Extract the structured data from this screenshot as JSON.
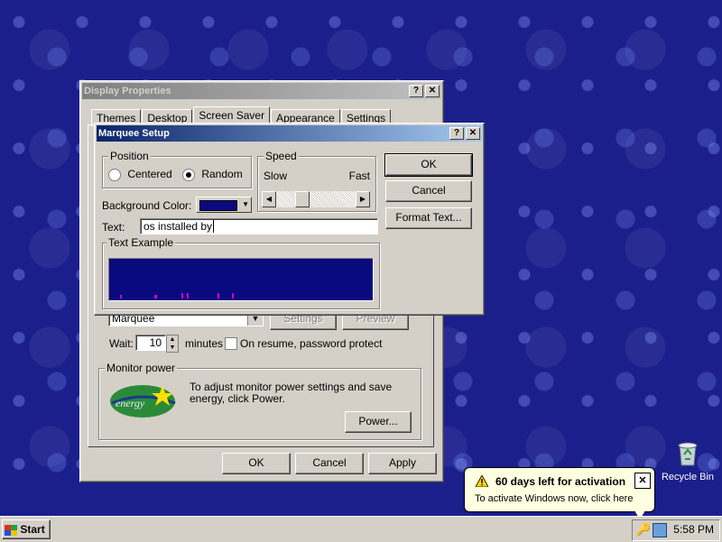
{
  "display_properties": {
    "title": "Display Properties",
    "tabs": [
      "Themes",
      "Desktop",
      "Screen Saver",
      "Appearance",
      "Settings"
    ],
    "selected_tab": "Screen Saver",
    "screensaver_select": "Marquee",
    "settings_label": "Settings",
    "preview_label": "Preview",
    "wait_label": "Wait:",
    "wait_value": "10",
    "minutes_label": "minutes",
    "resume_label": "On resume, password protect",
    "monitor_power_label": "Monitor power",
    "monitor_power_text": "To adjust monitor power settings and save energy, click Power.",
    "power_button": "Power...",
    "ok_button": "OK",
    "cancel_button": "Cancel",
    "apply_button": "Apply"
  },
  "marquee_setup": {
    "title": "Marquee Setup",
    "position_label": "Position",
    "centered_label": "Centered",
    "random_label": "Random",
    "position_selected": "Random",
    "speed_label": "Speed",
    "slow_label": "Slow",
    "fast_label": "Fast",
    "speed_level": 0.3,
    "background_color_label": "Background Color:",
    "background_color": "#0a0a80",
    "text_label": "Text:",
    "text_value": "os installed by",
    "text_example_label": "Text Example",
    "ok_button": "OK",
    "cancel_button": "Cancel",
    "format_text_button": "Format Text..."
  },
  "desktop": {
    "recycle_bin_label": "Recycle Bin"
  },
  "taskbar": {
    "start_label": "Start",
    "clock": "5:58 PM"
  },
  "balloon": {
    "title": "60 days left for activation",
    "text": "To activate Windows now, click here"
  },
  "colors": {
    "desktop": "#1b1f8c",
    "title_active": "#0a246a",
    "face": "#d4d0c8"
  }
}
